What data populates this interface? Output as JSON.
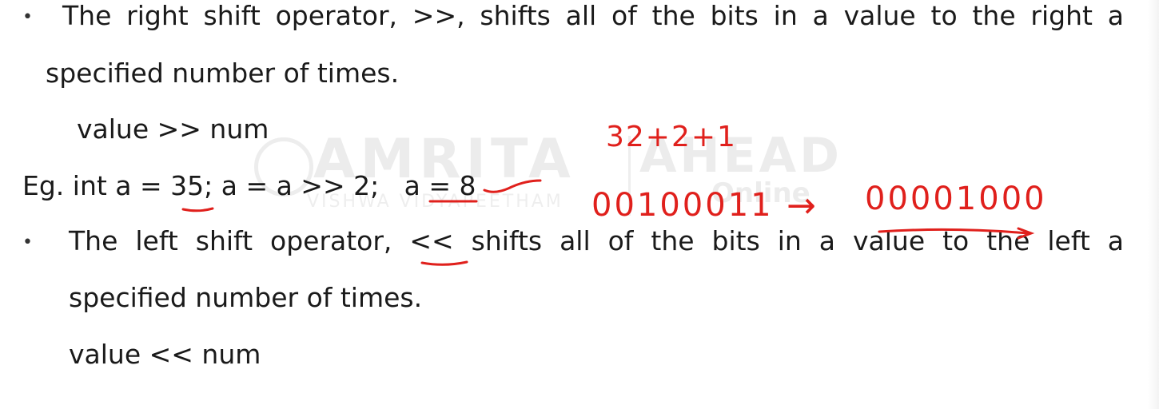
{
  "watermark": {
    "main": "AMRITA",
    "sub": "VISHWA VIDYAPEETHAM",
    "brand": "AHEAD",
    "brand_sub": "Online"
  },
  "bullets": [
    "•",
    "•"
  ],
  "right_shift": {
    "line1": "The right shift operator, >>, shifts all of the bits in a value to the right a",
    "line2": "specified number of times.",
    "syntax": "value >> num"
  },
  "example": {
    "text": "Eg. int a = 35; a = a >> 2;   a = 8"
  },
  "left_shift": {
    "line1": "The left shift operator, << shifts all of the bits in a value to the left a",
    "line2": "specified number of times.",
    "syntax": "value << num"
  },
  "annotations": {
    "sum": "32+2+1",
    "binary_before": "00100011",
    "arrow": "→",
    "binary_after": "00001000"
  },
  "colors": {
    "text": "#1a1a1a",
    "ink": "#e0201c",
    "watermark": "#ececec"
  }
}
